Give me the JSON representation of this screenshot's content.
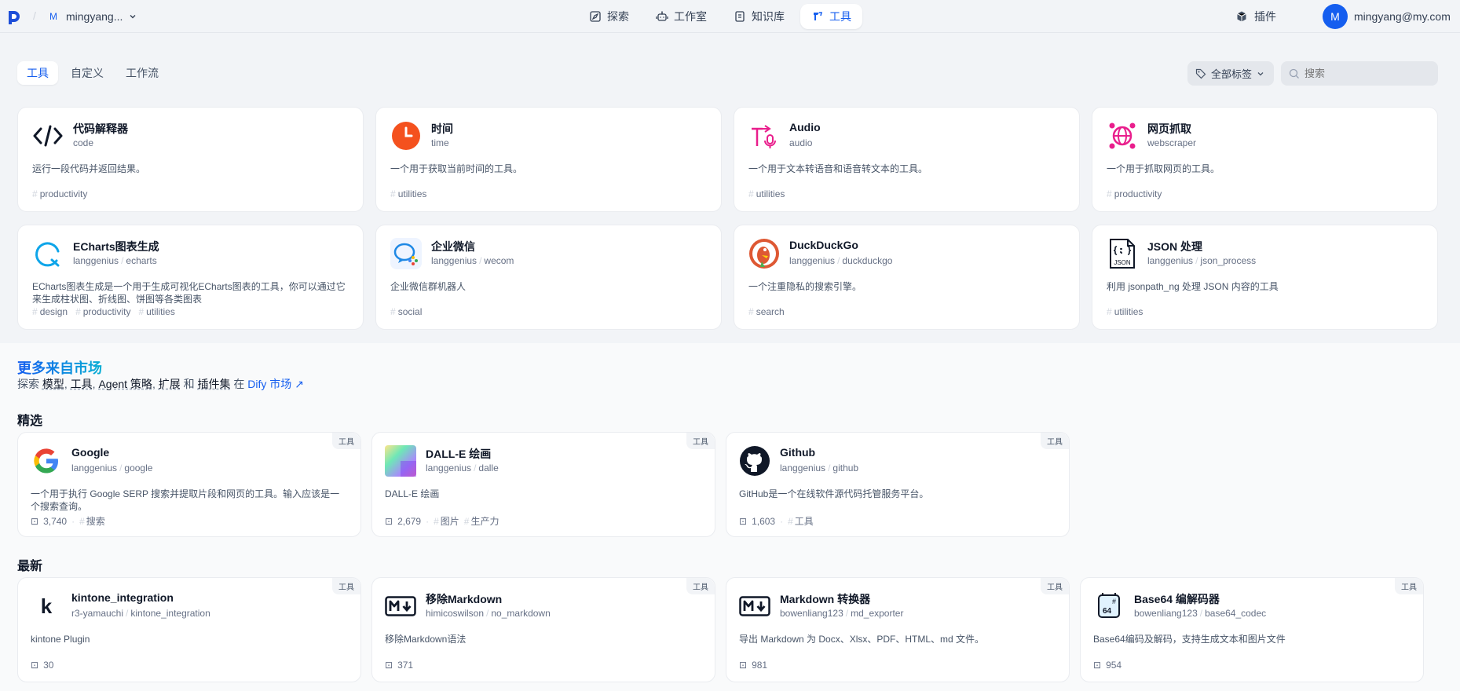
{
  "header": {
    "workspace_initial": "M",
    "workspace_name": "mingyang...",
    "nav": [
      {
        "label": "探索",
        "icon": "compass-icon"
      },
      {
        "label": "工作室",
        "icon": "robot-icon"
      },
      {
        "label": "知识库",
        "icon": "book-icon"
      },
      {
        "label": "工具",
        "icon": "tools-icon"
      }
    ],
    "plugin_label": "插件",
    "user_initial": "M",
    "user_email": "mingyang@my.com"
  },
  "subtabs": [
    "工具",
    "自定义",
    "工作流"
  ],
  "tag_filter_label": "全部标签",
  "search_placeholder": "搜索",
  "tools": [
    {
      "name": "代码解释器",
      "sub": "code",
      "desc": "运行一段代码并返回结果。",
      "tags": [
        "productivity"
      ]
    },
    {
      "name": "时间",
      "sub": "time",
      "desc": "一个用于获取当前时间的工具。",
      "tags": [
        "utilities"
      ]
    },
    {
      "name": "Audio",
      "sub": "audio",
      "desc": "一个用于文本转语音和语音转文本的工具。",
      "tags": [
        "utilities"
      ]
    },
    {
      "name": "网页抓取",
      "sub": "webscraper",
      "desc": "一个用于抓取网页的工具。",
      "tags": [
        "productivity"
      ]
    },
    {
      "name": "ECharts图表生成",
      "org": "langgenius",
      "sub": "echarts",
      "desc": "ECharts图表生成是一个用于生成可视化ECharts图表的工具，你可以通过它来生成柱状图、折线图、饼图等各类图表",
      "tags": [
        "design",
        "productivity",
        "utilities"
      ]
    },
    {
      "name": "企业微信",
      "org": "langgenius",
      "sub": "wecom",
      "desc": "企业微信群机器人",
      "tags": [
        "social"
      ]
    },
    {
      "name": "DuckDuckGo",
      "org": "langgenius",
      "sub": "duckduckgo",
      "desc": "一个注重隐私的搜索引擎。",
      "tags": [
        "search"
      ]
    },
    {
      "name": "JSON 处理",
      "org": "langgenius",
      "sub": "json_process",
      "desc": "利用 jsonpath_ng 处理 JSON 内容的工具",
      "tags": [
        "utilities"
      ]
    }
  ],
  "market": {
    "title": "更多来自市场",
    "sub_prefix": "探索",
    "sub_items": [
      "模型",
      "工具",
      "Agent 策略",
      "扩展"
    ],
    "sub_and": "和",
    "sub_last": "插件集",
    "sub_in": "在",
    "sub_link": "Dify 市场",
    "featured_label": "精选",
    "latest_label": "最新",
    "badge": "工具",
    "featured": [
      {
        "name": "Google",
        "org": "langgenius",
        "sub": "google",
        "desc": "一个用于执行 Google SERP 搜索并提取片段和网页的工具。输入应该是一个搜索查询。",
        "installs": "3,740",
        "tags": [
          "搜索"
        ]
      },
      {
        "name": "DALL-E 绘画",
        "org": "langgenius",
        "sub": "dalle",
        "desc": "DALL-E 绘画",
        "installs": "2,679",
        "tags": [
          "图片",
          "生产力"
        ]
      },
      {
        "name": "Github",
        "org": "langgenius",
        "sub": "github",
        "desc": "GitHub是一个在线软件源代码托管服务平台。",
        "installs": "1,603",
        "tags": [
          "工具"
        ]
      }
    ],
    "latest": [
      {
        "name": "kintone_integration",
        "org": "r3-yamauchi",
        "sub": "kintone_integration",
        "desc": "kintone Plugin",
        "installs": "30",
        "tags": []
      },
      {
        "name": "移除Markdown",
        "org": "himicoswilson",
        "sub": "no_markdown",
        "desc": "移除Markdown语法",
        "installs": "371",
        "tags": []
      },
      {
        "name": "Markdown 转换器",
        "org": "bowenliang123",
        "sub": "md_exporter",
        "desc": "导出 Markdown 为 Docx、Xlsx、PDF、HTML、md 文件。",
        "installs": "981",
        "tags": []
      },
      {
        "name": "Base64 编解码器",
        "org": "bowenliang123",
        "sub": "base64_codec",
        "desc": "Base64编码及解码，支持生成文本和图片文件",
        "installs": "954",
        "tags": []
      }
    ]
  },
  "colors": {
    "accent": "#155eef",
    "time": "#f4511e",
    "audio": "#e91e8c",
    "duck": "#de5833"
  }
}
